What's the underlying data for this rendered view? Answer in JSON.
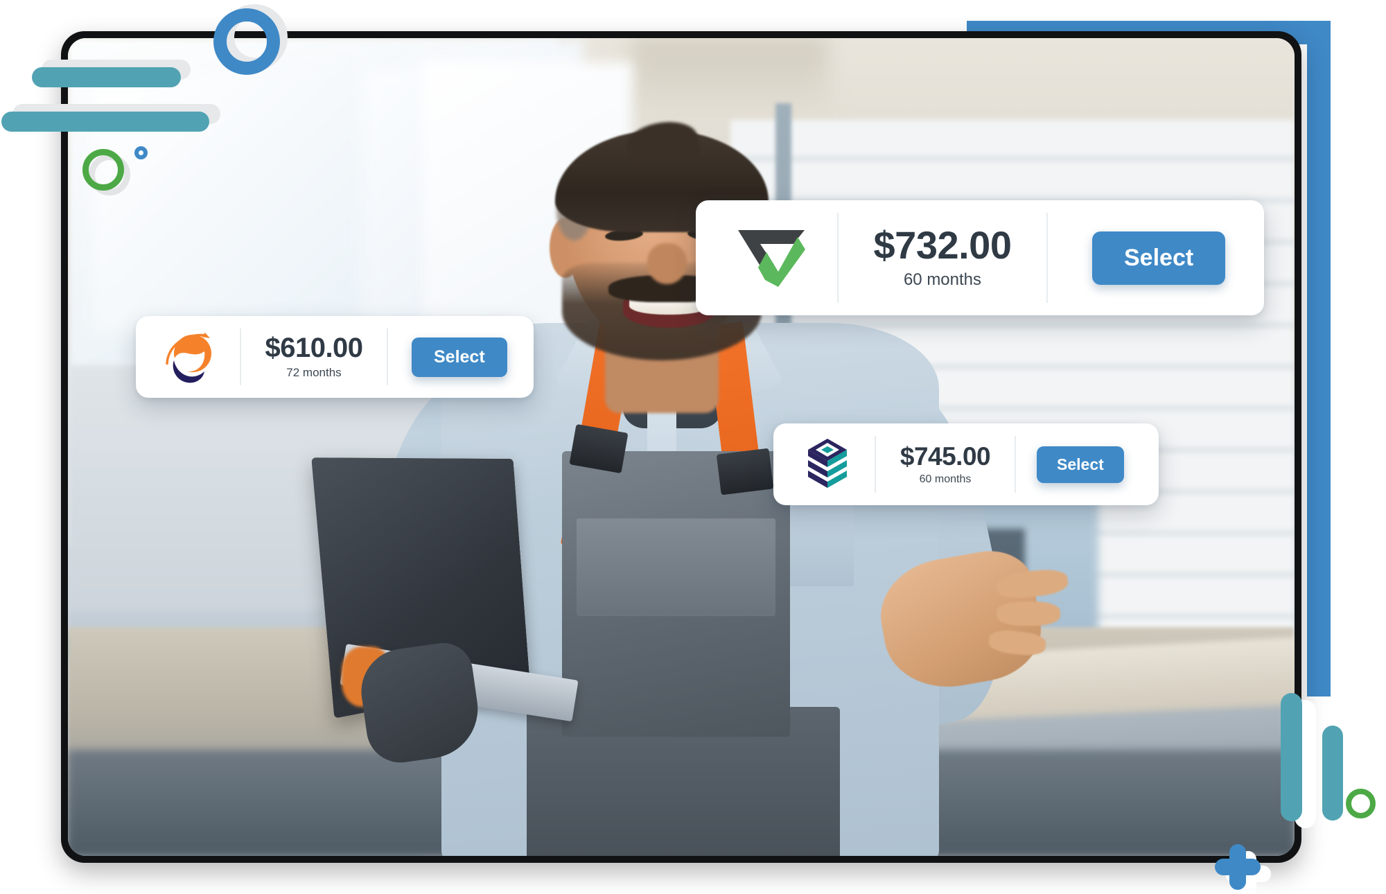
{
  "page": {
    "title": "Financing offer selection",
    "accent_blue": "#3f89c7",
    "accent_teal": "#51a3b3",
    "accent_green": "#4ca946",
    "card_background": "#ffffff",
    "price_text_color": "#2f3a45"
  },
  "photo": {
    "alt": "Smiling workshop technician in gray overalls with orange straps holding an open laptop, arm outstretched, in a blurred garage workshop",
    "frame_color": "#111214"
  },
  "offers": [
    {
      "id": "offer-1",
      "lender_logo": "triangle-check-logo",
      "logo_colors": {
        "primary": "#3f4245",
        "accent": "#5cb85c"
      },
      "price": "$732.00",
      "term": "60 months",
      "select_label": "Select"
    },
    {
      "id": "offer-2",
      "lender_logo": "orange-wave-globe-logo",
      "logo_colors": {
        "primary": "#f5822b",
        "accent": "#231e5e"
      },
      "price": "$610.00",
      "term": "72 months",
      "select_label": "Select"
    },
    {
      "id": "offer-3",
      "lender_logo": "teal-hexagon-layers-logo",
      "logo_colors": {
        "primary": "#159c9c",
        "accent": "#2b2560"
      },
      "price": "$745.00",
      "term": "60 months",
      "select_label": "Select"
    }
  ],
  "decorations": {
    "top_left": [
      {
        "name": "blue-ring",
        "color": "#3f89c7"
      },
      {
        "name": "teal-bar-short",
        "color": "#51a3b3"
      },
      {
        "name": "teal-bar-long",
        "color": "#51a3b3"
      },
      {
        "name": "green-ring",
        "color": "#4ca946"
      },
      {
        "name": "blue-dot-ring",
        "color": "#3f89c7"
      }
    ],
    "top_right": [
      {
        "name": "blue-corner-frame",
        "color": "#3f89c7"
      }
    ],
    "bottom_right": [
      {
        "name": "teal-vertical-bar-tall",
        "color": "#51a3b3"
      },
      {
        "name": "teal-vertical-bar-short",
        "color": "#51a3b3"
      },
      {
        "name": "green-ring",
        "color": "#4ca946"
      },
      {
        "name": "blue-plus",
        "color": "#3f89c7"
      }
    ]
  }
}
